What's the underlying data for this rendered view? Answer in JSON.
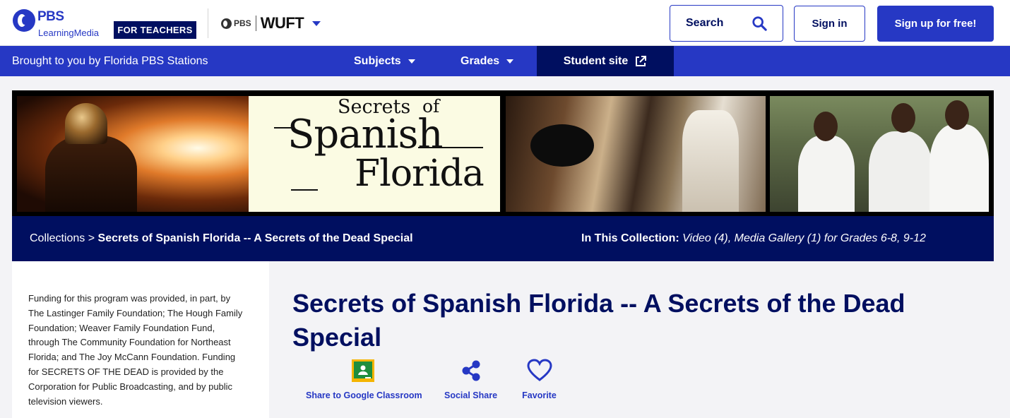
{
  "header": {
    "logo_brand": "PBS",
    "logo_product": "LearningMedia",
    "audience_badge": "FOR TEACHERS",
    "station_network": "PBS",
    "station_name": "WUFT",
    "search_label": "Search",
    "signin_label": "Sign in",
    "signup_label": "Sign up for free!"
  },
  "nav": {
    "brought_by": "Brought to you by Florida PBS Stations",
    "subjects_label": "Subjects",
    "grades_label": "Grades",
    "student_site_label": "Student site"
  },
  "banner": {
    "title_line1_a": "Secrets",
    "title_line1_b": "of",
    "title_line2": "Spanish",
    "title_line3": "Florida"
  },
  "collection_bar": {
    "breadcrumb_root": "Collections",
    "breadcrumb_sep": ">",
    "breadcrumb_current": "Secrets of Spanish Florida -- A Secrets of the Dead Special",
    "in_collection_label": "In This Collection:",
    "in_collection_value": "Video (4), Media Gallery (1) for Grades 6-8, 9-12"
  },
  "sidebar": {
    "funding_text": "Funding for this program was provided, in part, by The Lastinger Family Foundation; The Hough Family Foundation; Weaver Family Foundation Fund, through The Community Foundation for Northeast Florida; and The Joy McCann Foundation. Funding for SECRETS OF THE DEAD is provided by the Corporation for Public Broadcasting, and by public television viewers."
  },
  "main": {
    "title": "Secrets of Spanish Florida -- A Secrets of the Dead Special",
    "actions": {
      "google_classroom": "Share to Google Classroom",
      "social_share": "Social Share",
      "favorite": "Favorite"
    }
  },
  "colors": {
    "primary_blue": "#2638c4",
    "navy": "#000f60",
    "google_classroom_green": "#1e8e3e",
    "google_classroom_yellow": "#f4b400"
  },
  "icons": [
    "search-icon",
    "external-link-icon",
    "google-classroom-icon",
    "share-icon",
    "heart-icon",
    "chevron-down-icon"
  ]
}
